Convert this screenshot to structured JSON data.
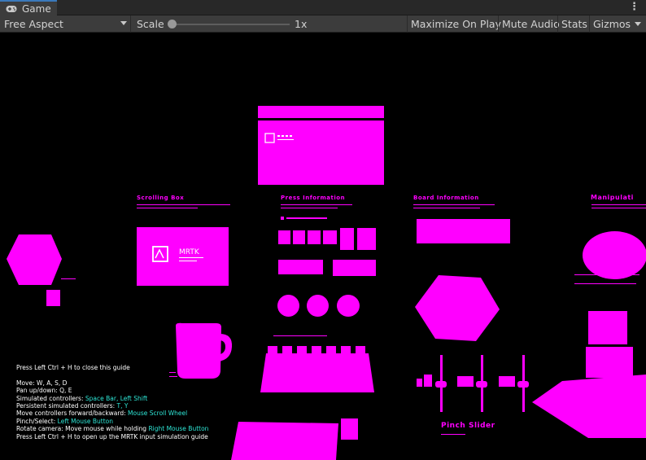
{
  "tab": {
    "title": "Game",
    "icon": "gamepad-icon"
  },
  "toolbar": {
    "aspect": "Free Aspect",
    "scale_label": "Scale",
    "scale_value": "1x",
    "scale_level": 0.0,
    "maximize": "Maximize On Play",
    "mute": "Mute Audio",
    "stats": "Stats",
    "gizmos": "Gizmos"
  },
  "scene": {
    "accent": "#ff00ff",
    "logo_text": "MRTK"
  },
  "guide": {
    "close_hint": "Press Left Ctrl + H to close this guide",
    "move_label": "Move:",
    "move_keys": "W, A, S, D",
    "pan_label": "Pan up/down:",
    "pan_keys": "Q, E",
    "sim_label": "Simulated controllers:",
    "sim_keys": "Space Bar, Left Shift",
    "persist_label": "Persistent simulated controllers:",
    "persist_keys": "T, Y",
    "fwd_label": "Move controllers forward/backward:",
    "fwd_keys": "Mouse Scroll Wheel",
    "pinch_label": "Pinch/Select:",
    "pinch_keys": "Left Mouse Button",
    "rotate_label": "Rotate camera: Move mouse while holding",
    "rotate_keys": "Right Mouse Button",
    "reopen_hint": "Press Left Ctrl + H to open up the MRTK input simulation guide",
    "highlight": "#2ee6d6"
  }
}
